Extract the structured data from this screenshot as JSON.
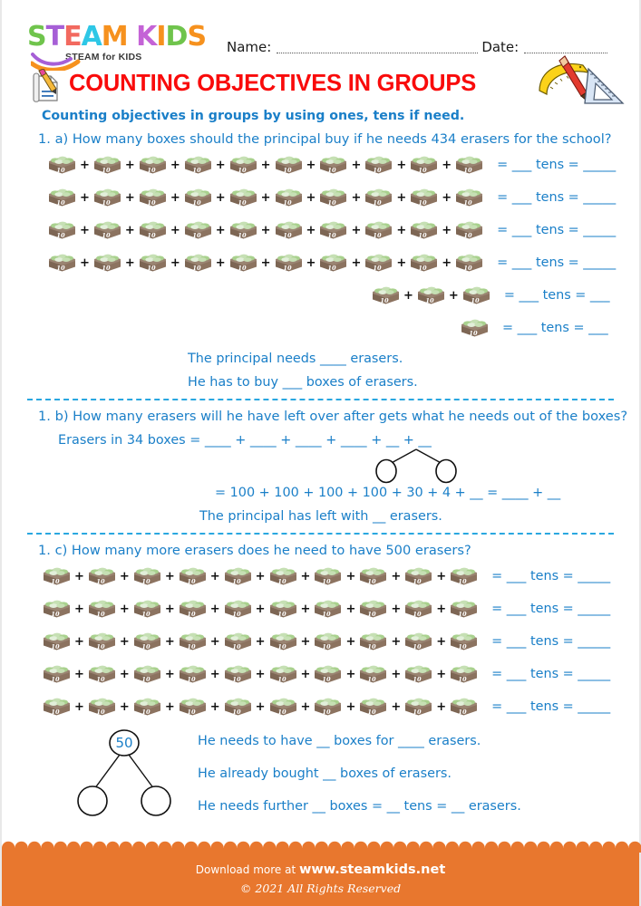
{
  "brand": {
    "logo_letters": [
      {
        "ch": "S",
        "color": "#6fc44c"
      },
      {
        "ch": "T",
        "color": "#a65fd6"
      },
      {
        "ch": "E",
        "color": "#f2695f"
      },
      {
        "ch": "A",
        "color": "#2ec7e6"
      },
      {
        "ch": "M",
        "color": "#f6911e"
      },
      {
        "ch": " ",
        "color": "#ffffff"
      },
      {
        "ch": "K",
        "color": "#c463d6"
      },
      {
        "ch": "I",
        "color": "#f6911e"
      },
      {
        "ch": "D",
        "color": "#6fc44c"
      },
      {
        "ch": "S",
        "color": "#f6911e"
      }
    ],
    "logo_tagline": "STEAM for KIDS"
  },
  "header": {
    "name_label": "Name:",
    "date_label": "Date:"
  },
  "title": "COUNTING OBJECTIVES IN GROUPS",
  "subtitle": "Counting objectives in groups by using ones, tens if need.",
  "colors": {
    "title_red": "#f90b0b",
    "text_blue": "#1a7fc8",
    "divider_blue": "#29a7e0",
    "footer_orange": "#e8772e",
    "box_brown": "#8c7360",
    "eraser_green": "#a8d08d"
  },
  "questions": [
    {
      "id": "1a",
      "prompt": "1. a)  How many boxes should the principal buy if he needs 434 erasers for the school?",
      "rows": [
        {
          "boxes": 10,
          "indent": 0,
          "tail": "=  ___  tens =  _____"
        },
        {
          "boxes": 10,
          "indent": 0,
          "tail": "=  ___  tens =  _____"
        },
        {
          "boxes": 10,
          "indent": 0,
          "tail": "=  ___  tens =  _____"
        },
        {
          "boxes": 10,
          "indent": 0,
          "tail": "=  ___  tens =  _____"
        },
        {
          "boxes": 3,
          "indent": 357,
          "tail": "=  ___  tens =  ___"
        },
        {
          "boxes": 1,
          "indent": 455,
          "tail": "=  ___  tens =  ___"
        }
      ],
      "statements": [
        {
          "text": "The principal needs ____ erasers.",
          "indent": 205
        },
        {
          "text": "He has to buy ___ boxes of erasers.",
          "indent": 205
        }
      ]
    },
    {
      "id": "1b",
      "prompt": "1. b)  How many erasers will he have left over after gets what he needs out of the boxes?",
      "equation_line": "Erasers in 34 boxes = ____ + ____ + ____ + ____ + __ + __",
      "equation_line_indent": 62,
      "result_line": "= 100 + 100 + 100 + 100 + 30 + 4 + __  =  ____ + __",
      "result_line_indent": 235,
      "statement": "The principal has left with __ erasers.",
      "statement_indent": 218,
      "bond": {
        "top_value": "",
        "left_value": "",
        "right_value": ""
      }
    },
    {
      "id": "1c",
      "prompt": "1. c)  How many more erasers does he need to have 500 erasers?",
      "rows": [
        {
          "boxes": 10,
          "indent": 0,
          "tail": "=  ___  tens =  _____"
        },
        {
          "boxes": 10,
          "indent": 0,
          "tail": "=  ___  tens =  _____"
        },
        {
          "boxes": 10,
          "indent": 0,
          "tail": "=  ___  tens =  _____"
        },
        {
          "boxes": 10,
          "indent": 0,
          "tail": "=  ___  tens =  _____"
        },
        {
          "boxes": 10,
          "indent": 0,
          "tail": "=  ___  tens =  _____"
        }
      ],
      "bond": {
        "top_value": "50",
        "left_value": "",
        "right_value": ""
      },
      "statements": [
        {
          "text": "He needs to have __ boxes for ____ erasers."
        },
        {
          "text": "He already bought __ boxes of erasers."
        },
        {
          "text": "He needs further __ boxes = __ tens = __ erasers."
        }
      ]
    }
  ],
  "box_icon": {
    "label": "10",
    "name": "eraser-box-icon"
  },
  "footer": {
    "download_prefix": "Download more at",
    "website": "www.steamkids.net",
    "copyright": "© 2021 All Rights Reserved"
  }
}
